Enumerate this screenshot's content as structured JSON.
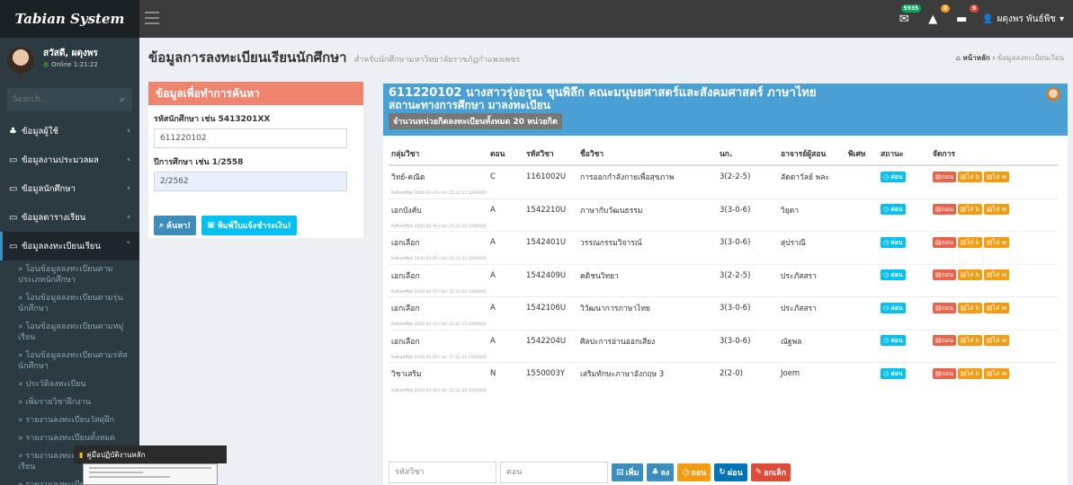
{
  "app": {
    "logo": "Tabian System"
  },
  "topbar": {
    "mail_badge": "5935",
    "alert_badge": "0",
    "task_badge": "9",
    "user": "ผดุงพร พันธ์พืช"
  },
  "sidebar": {
    "user_name": "สวัสดี, ผดุงพร",
    "user_status": "Online 1:21:22",
    "search_placeholder": "Search...",
    "items": [
      {
        "label": "ข้อมูลผู้ใช้"
      },
      {
        "label": "ข้อมูลงานประมวลผล"
      },
      {
        "label": "ข้อมูลนักศึกษา"
      },
      {
        "label": "ข้อมูลตารางเรียน"
      },
      {
        "label": "ข้อมูลลงทะเบียนเรียน"
      }
    ],
    "subitems": [
      "» โอนข้อมูลลงทะเบียนตามประเภทนักศึกษา",
      "» โอนข้อมูลลงทะเบียนตามรุ่นนักศึกษา",
      "» โอนข้อมูลลงทะเบียนตามหมู่เรียน",
      "» โอนข้อมูลลงทะเบียนตามรหัสนักศึกษา",
      "» ประวัติลงทะเบียน",
      "» เพิ่มรายวิชาฝึกงาน",
      "» รายงานลงทะเบียนวัสดุฝึก",
      "» รายงานลงทะเบียนทั้งหมด",
      "» รายงานลงทะเบียนตามหมู่เรียน",
      "» รายงานลงทะเบียนตามรายวิชา"
    ],
    "taskbar_title": "คู่มือปฏิบัติงานหลัก"
  },
  "header": {
    "title": "ข้อมูลการลงทะเบียนเรียนนักศึกษา",
    "subtitle": "สำหรับนักศึกษามหาวิทยาลัยราชภัฏกำแพงเพชร",
    "breadcrumb_home": "หน้าหลัก",
    "breadcrumb_current": "ข้อมูลลงทะเบียนเรียน"
  },
  "search": {
    "box_title": "ข้อมูลเพื่อทำการค้นหา",
    "student_label": "รหัสนักศึกษา เช่น 5413201XX",
    "student_value": "611220102",
    "term_label": "ปีการศึกษา เช่น 1/2558",
    "term_value": "2/2562",
    "search_button": "ค้นหา!",
    "print_button": "พิมพ์ใบแจ้งชำระเงิน!"
  },
  "student": {
    "line1": "611220102 นางสาวรุ่งอรุณ ขุนพิลึก คณะมนุษยศาสตร์และสังคมศาสตร์ ภาษาไทย",
    "line2": "สถานะทางการศึกษา มาลงทะเบียน",
    "credit_badge": "จำนวนหน่วยกิตลงทะเบียนทั้งหมด 20 หน่วยกิต"
  },
  "table": {
    "headers": [
      "กลุ่มวิชา",
      "ตอน",
      "รหัสวิชา",
      "ชื่อวิชา",
      "นก.",
      "อาจารย์ผู้สอน",
      "พิเศษ",
      "สถานะ",
      "จัดการ"
    ],
    "status_label": "ผ่อน",
    "action_labels": [
      "ถอน",
      "ไส่ b",
      "ไส่ w"
    ],
    "meta_text": "ลิงค์เลขที่ชุด 2020-02-05 เวลา 15:21:15.5000000",
    "rows": [
      {
        "group": "วิทย์-คณิต",
        "section": "C",
        "code": "1161002U",
        "name": "การออกกำลังกายเพื่อสุขภาพ",
        "credit": "3(2-2-5)",
        "teacher": "ลัดดาวัลย์ พละ"
      },
      {
        "group": "เอกบังคับ",
        "section": "A",
        "code": "1542210U",
        "name": "ภาษากับวัฒนธรรม",
        "credit": "3(3-0-6)",
        "teacher": "วิยุดา"
      },
      {
        "group": "เอกเลือก",
        "section": "A",
        "code": "1542401U",
        "name": "วรรณกรรมวิจารณ์",
        "credit": "3(3-0-6)",
        "teacher": "สุปราณี"
      },
      {
        "group": "เอกเลือก",
        "section": "A",
        "code": "1542409U",
        "name": "คติชนวิทยา",
        "credit": "3(2-2-5)",
        "teacher": "ประภัสสรา"
      },
      {
        "group": "เอกเลือก",
        "section": "A",
        "code": "1542106U",
        "name": "วิวัฒนาการภาษาไทย",
        "credit": "3(3-0-6)",
        "teacher": "ประภัสสรา"
      },
      {
        "group": "เอกเลือก",
        "section": "A",
        "code": "1542204U",
        "name": "ศิลปะการอ่านออกเสียง",
        "credit": "3(3-0-6)",
        "teacher": "ณัฐพล"
      },
      {
        "group": "วิชาเสริม",
        "section": "N",
        "code": "1550003Y",
        "name": "เสริมทักษะภาษาอังกฤษ 3",
        "credit": "2(2-0)",
        "teacher": "Joem"
      }
    ]
  },
  "form": {
    "code_placeholder": "รหัสวิชา",
    "section_placeholder": "ตอน",
    "add_button": "เพิ่ม",
    "down_button": "ลง",
    "withdraw_button": "ถอน",
    "installment_button": "ผ่อน",
    "cancel_button": "ยกเลิก"
  }
}
